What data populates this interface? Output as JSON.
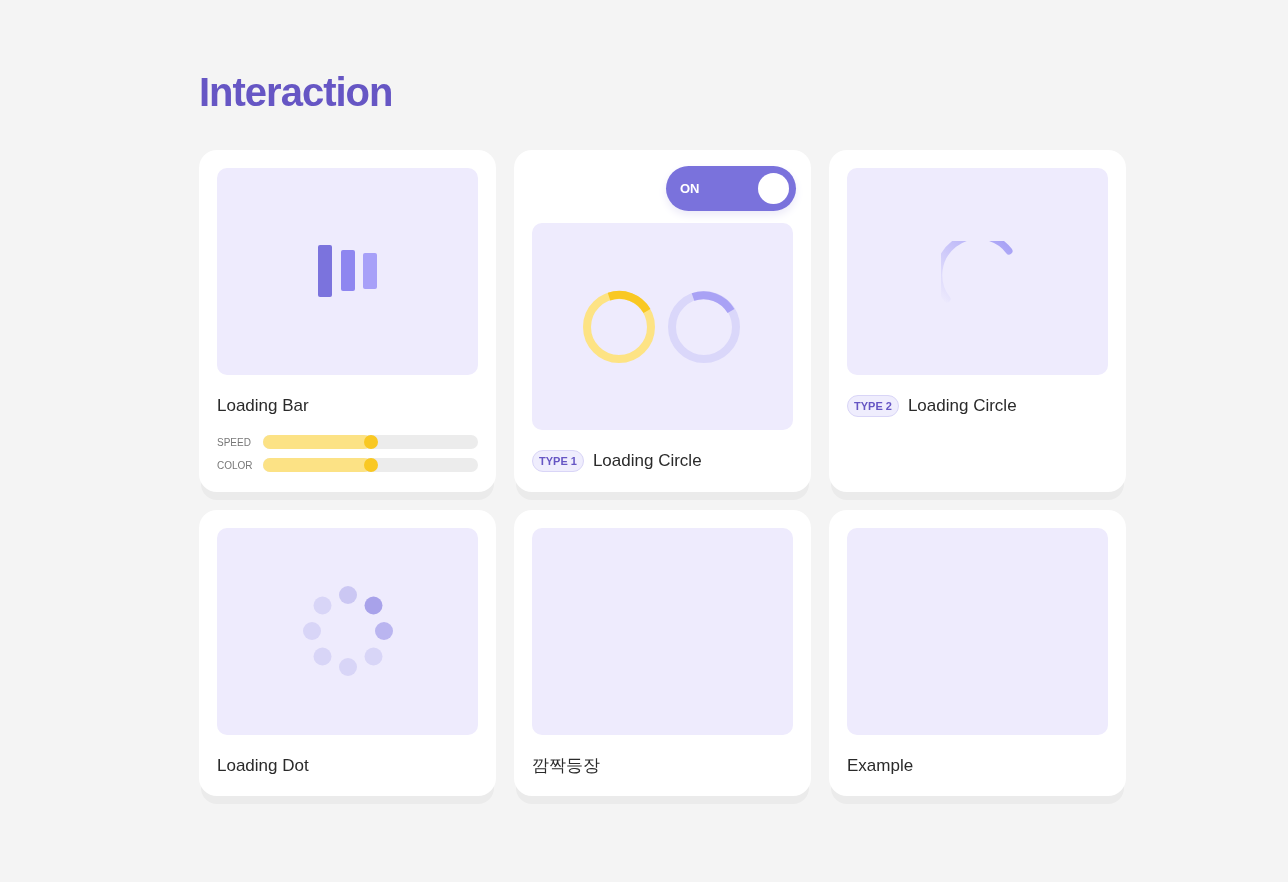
{
  "heading": "Interaction",
  "cards": [
    {
      "kind": "bars",
      "title": "Loading Bar",
      "sliders": [
        {
          "label": "SPEED",
          "level": 0.5
        },
        {
          "label": "COLOR",
          "level": 0.5
        }
      ]
    },
    {
      "kind": "circles",
      "title": "Loading Circle",
      "badge": "TYPE 1",
      "toggle": {
        "label": "ON",
        "on": true
      }
    },
    {
      "kind": "spinner",
      "title": "Loading Circle",
      "badge": "TYPE 2"
    },
    {
      "kind": "dots",
      "title": "Loading Dot"
    },
    {
      "kind": "empty",
      "title": "깜짝등장"
    },
    {
      "kind": "empty",
      "title": "Example"
    }
  ]
}
